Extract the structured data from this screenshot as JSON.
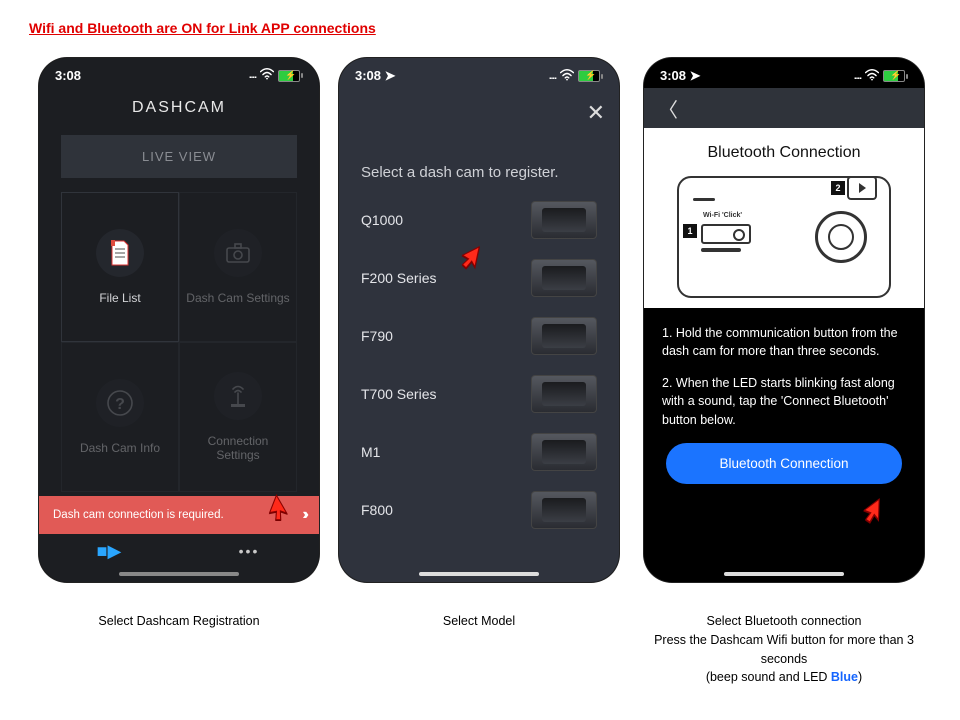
{
  "headline": "Wifi and Bluetooth are ON for Link APP connections",
  "status": {
    "time": "3:08"
  },
  "phone1": {
    "title": "DASHCAM",
    "live_view": "LIVE VIEW",
    "cells": {
      "file_list": "File List",
      "settings": "Dash Cam Settings",
      "info": "Dash Cam Info",
      "conn": "Connection\nSettings"
    },
    "banner": "Dash cam connection is required."
  },
  "phone2": {
    "prompt": "Select a dash cam to register.",
    "models": [
      "Q1000",
      "F200 Series",
      "F790",
      "T700 Series",
      "M1",
      "F800"
    ]
  },
  "phone3": {
    "white_title": "Bluetooth Connection",
    "wifi_label": "Wi-Fi 'Click'",
    "step1": "1. Hold the communication button from the dash cam for more than three seconds.",
    "step2": "2. When the LED starts blinking fast along with a sound, tap the 'Connect Bluetooth' button below.",
    "cta": "Bluetooth Connection"
  },
  "captions": {
    "c1": "Select Dashcam Registration",
    "c2": "Select Model",
    "c3_a": "Select Bluetooth connection",
    "c3_b": "Press the Dashcam Wifi button for more than 3 seconds",
    "c3_c_pre": "(beep sound and LED ",
    "c3_c_blue": "Blue",
    "c3_c_post": ")"
  }
}
